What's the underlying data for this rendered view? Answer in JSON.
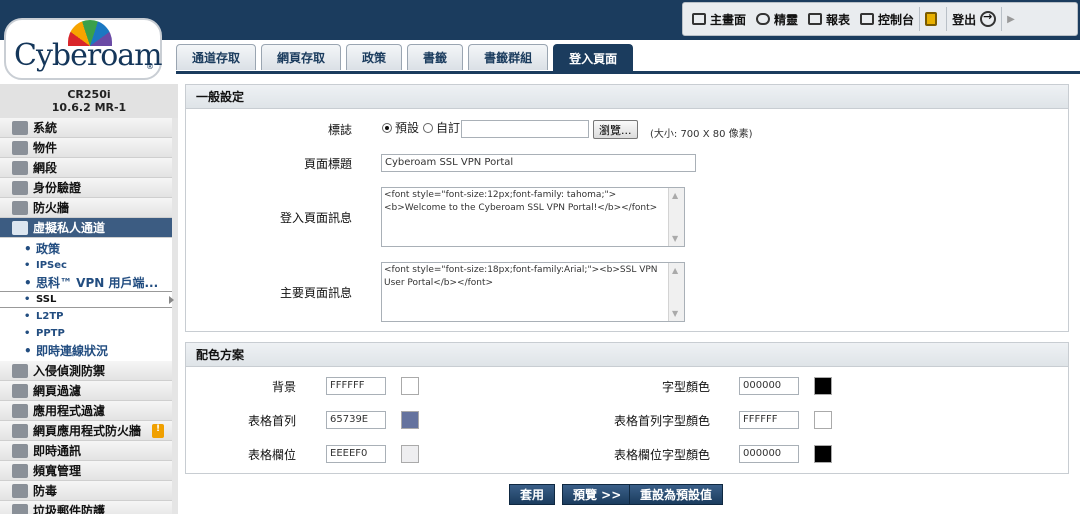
{
  "top_links": [
    {
      "label": "主畫面",
      "icon": "home-icon"
    },
    {
      "label": "精靈",
      "icon": "wizard-icon"
    },
    {
      "label": "報表",
      "icon": "reports-icon"
    },
    {
      "label": "控制台",
      "icon": "console-icon"
    },
    {
      "label": "登出",
      "icon": "logout-icon"
    }
  ],
  "logo": {
    "text": "Cyberoam",
    "reg": "®"
  },
  "device": {
    "model": "CR250i",
    "version": "10.6.2 MR-1"
  },
  "nav": {
    "items_before": [
      "系統",
      "物件",
      "網段",
      "身份驗證",
      "防火牆"
    ],
    "active": "虛擬私人通道",
    "sub": [
      "政策",
      "IPSec",
      "思科™ VPN 用戶端...",
      "SSL",
      "L2TP",
      "PPTP",
      "即時連線狀況"
    ],
    "items_after": [
      "入侵偵測防禦",
      "網頁過濾",
      "應用程式過濾",
      "網頁應用程式防火牆",
      "即時通訊",
      "頻寬管理",
      "防毒",
      "垃圾郵件防護"
    ]
  },
  "tabs": [
    "通道存取",
    "網頁存取",
    "政策",
    "書籤",
    "書籤群組",
    "登入頁面"
  ],
  "active_tab": "登入頁面",
  "general": {
    "title": "一般設定",
    "logo_label": "標誌",
    "radio_default": "預設",
    "radio_custom": "自訂",
    "browse_label": "瀏覽...",
    "size_hint": "(大小: 700 X 80 像素)",
    "page_title_label": "頁面標題",
    "page_title_value": "Cyberoam SSL VPN Portal",
    "login_msg_label": "登入頁面訊息",
    "login_msg_value": "<font style=\"font-size:12px;font-family: tahoma;\"><b>Welcome to the Cyberoam SSL VPN Portal!</b></font>",
    "main_msg_label": "主要頁面訊息",
    "main_msg_value": "<font style=\"font-size:18px;font-family:Arial;\"><b>SSL VPN User Portal</b></font>"
  },
  "colors": {
    "title": "配色方案",
    "background_label": "背景",
    "background_value": "FFFFFF",
    "header_label": "表格首列",
    "header_value": "65739E",
    "row_label": "表格欄位",
    "row_value": "EEEEF0",
    "font_label": "字型顏色",
    "font_value": "000000",
    "header_font_label": "表格首列字型顏色",
    "header_font_value": "FFFFFF",
    "row_font_label": "表格欄位字型顏色",
    "row_font_value": "000000",
    "swatches": {
      "background": "#FFFFFF",
      "header": "#65739E",
      "row": "#EEEEF0",
      "font": "#000000",
      "header_font": "#FFFFFF",
      "row_font": "#000000"
    }
  },
  "actions": {
    "apply": "套用",
    "preview": "預覽 >>",
    "reset": "重設為預設值"
  }
}
